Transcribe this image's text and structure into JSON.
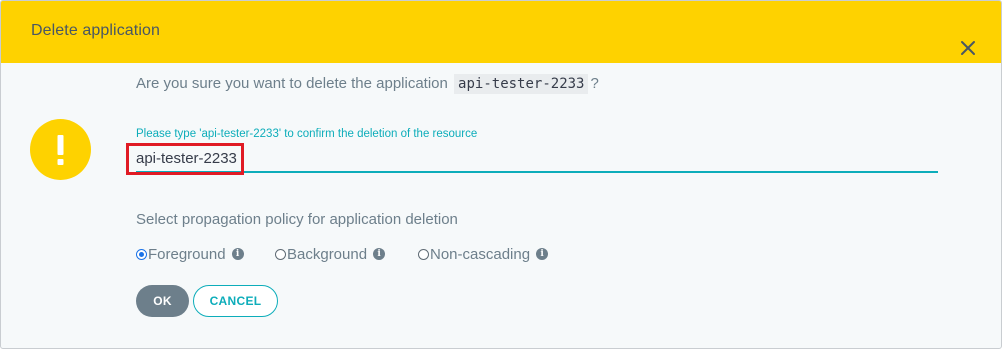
{
  "dialog": {
    "title": "Delete application",
    "close_icon": "close-icon"
  },
  "prompt": {
    "prefix": "Are you sure you want to delete the application",
    "app_name": "api-tester-2233",
    "suffix": "?"
  },
  "confirm": {
    "label": "Please type 'api-tester-2233' to confirm the deletion of the resource",
    "value": "api-tester-2233",
    "accent_color": "#0dadba",
    "highlight_color": "#e01b24"
  },
  "warning": {
    "icon": "exclamation-icon",
    "color": "#fed200"
  },
  "propagation": {
    "title": "Select propagation policy for application deletion",
    "options": [
      {
        "label": "Foreground",
        "checked": true
      },
      {
        "label": "Background",
        "checked": false
      },
      {
        "label": "Non-cascading",
        "checked": false
      }
    ],
    "info_icon": "info-icon"
  },
  "buttons": {
    "ok": "OK",
    "cancel": "CANCEL"
  },
  "colors": {
    "header": "#fed200",
    "ok_button": "#6d7f8b"
  }
}
